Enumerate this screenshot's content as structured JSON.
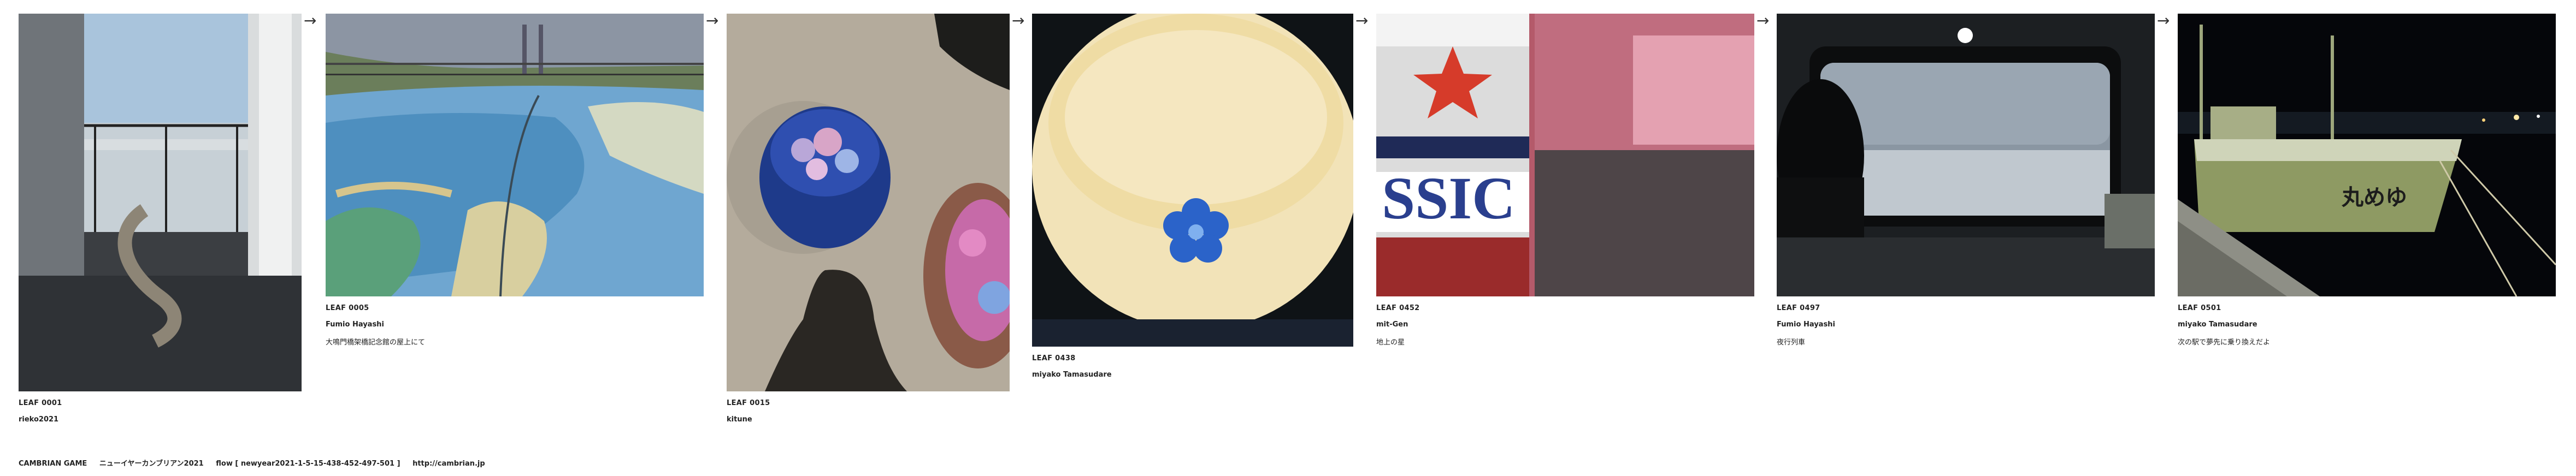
{
  "leaves": [
    {
      "id_label": "LEAF 0001",
      "author": "rieko2021",
      "caption": "",
      "image_icon": "balcony-photo"
    },
    {
      "id_label": "LEAF 0005",
      "author": "Fumio Hayashi",
      "caption": "大鳴門橋架橋記念館の屋上にて",
      "image_icon": "rooftop-map-photo"
    },
    {
      "id_label": "LEAF 0015",
      "author": "kitune",
      "caption": "",
      "image_icon": "hydrangea-bowl-photo"
    },
    {
      "id_label": "LEAF 0438",
      "author": "miyako Tamasudare",
      "caption": "",
      "image_icon": "ceramic-bowl-photo"
    },
    {
      "id_label": "LEAF 0452",
      "author": "mit-Gen",
      "caption": "地上の星",
      "image_icon": "beer-can-photo"
    },
    {
      "id_label": "LEAF 0497",
      "author": "Fumio Hayashi",
      "caption": "夜行列車",
      "image_icon": "train-window-photo"
    },
    {
      "id_label": "LEAF 0501",
      "author": "miyako Tamasudare",
      "caption": "次の駅で夢先に乗り換えだよ",
      "image_icon": "fishing-boat-photo"
    }
  ],
  "arrow_glyph": "→",
  "footer": {
    "site": "CAMBRIAN GAME",
    "title": "ニューイヤーカンブリアン2021",
    "flow": "flow [ newyear2021-1-5-15-438-452-497-501 ]",
    "url": "http://cambrian.jp"
  }
}
